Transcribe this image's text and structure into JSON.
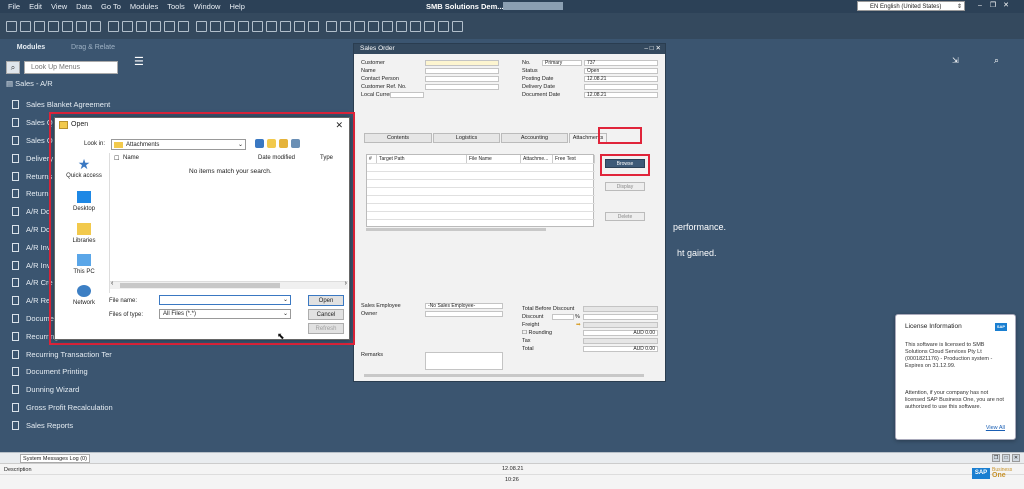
{
  "menubar": {
    "items": [
      "File",
      "Edit",
      "View",
      "Data",
      "Go To",
      "Modules",
      "Tools",
      "Window",
      "Help"
    ],
    "app_title": "SMB Solutions Dem...",
    "language": "EN English (United States)"
  },
  "leftpane": {
    "tab_modules": "Modules",
    "tab_drag": "Drag & Relate",
    "search_placeholder": "Look Up Menus",
    "module_header": "Sales - A/R",
    "items": [
      "Sales Blanket Agreement",
      "Sales Q",
      "Sales O",
      "Delivery",
      "Returns",
      "Return",
      "A/R Do",
      "A/R Do",
      "A/R Inv",
      "A/R Inv",
      "A/R Cre",
      "A/R Re",
      "Docume",
      "Recurring",
      "Recurring Transaction Ter",
      "Document Printing",
      "Dunning Wizard",
      "Gross Profit Recalculation",
      "Sales Reports"
    ]
  },
  "background": {
    "line1": "performance.",
    "line2": "ht gained."
  },
  "sales_order": {
    "title": "Sales Order",
    "left_labels": [
      "Customer",
      "Name",
      "Contact Person",
      "Customer Ref. No.",
      "Local Currency"
    ],
    "right_labels": [
      "No.",
      "Status",
      "Posting Date",
      "Delivery Date",
      "Document Date"
    ],
    "series": "Primary",
    "number": "737",
    "status": "Open",
    "posting_date": "12.08.21",
    "document_date": "12.08.21",
    "tabs": [
      "Contents",
      "Logistics",
      "Accounting",
      "Attachments"
    ],
    "grid_headers": [
      "#",
      "Target Path",
      "File Name",
      "Attachme...",
      "Free Text"
    ],
    "buttons": {
      "browse": "Browse",
      "display": "Display",
      "delete": "Delete"
    },
    "footer_left": [
      "Sales Employee",
      "Owner",
      "Remarks"
    ],
    "sales_employee": "-No Sales Employee-",
    "footer_right": [
      "Total Before Discount",
      "Discount",
      "Freight",
      "Rounding",
      "Tax",
      "Total"
    ],
    "percent": "%",
    "rounding_value": "AUD 0.00",
    "total_value": "AUD 0.00"
  },
  "open_dialog": {
    "title": "Open",
    "look_in_label": "Look in:",
    "look_in_value": "Attachments",
    "places": [
      "Quick access",
      "Desktop",
      "Libraries",
      "This PC",
      "Network"
    ],
    "columns": [
      "Name",
      "Date modified",
      "Type"
    ],
    "empty_message": "No items match your search.",
    "file_name_label": "File name:",
    "file_name_value": "",
    "files_of_type_label": "Files of type:",
    "files_of_type_value": "All Files (*.*)",
    "buttons": {
      "open": "Open",
      "cancel": "Cancel",
      "refresh": "Refresh"
    }
  },
  "license": {
    "title": "License Information",
    "body": "This software is licensed to SMB Solutions Cloud Services Pty Lt (0001821176) - Production system - Expires on 31.12.99.",
    "warning": "Attention, if your company has not licensed SAP Business One, you are not authorized to use this software.",
    "link": "View All"
  },
  "bottom": {
    "msglog_tab": "System Messages Log (0)",
    "description_label": "Description",
    "date": "12.08.21",
    "time": "10:26",
    "sap": "SAP",
    "business": "Business",
    "one": "One"
  },
  "colors": {
    "accent": "#e0243a",
    "primary": "#3d5a78",
    "background": "#3b5570"
  }
}
